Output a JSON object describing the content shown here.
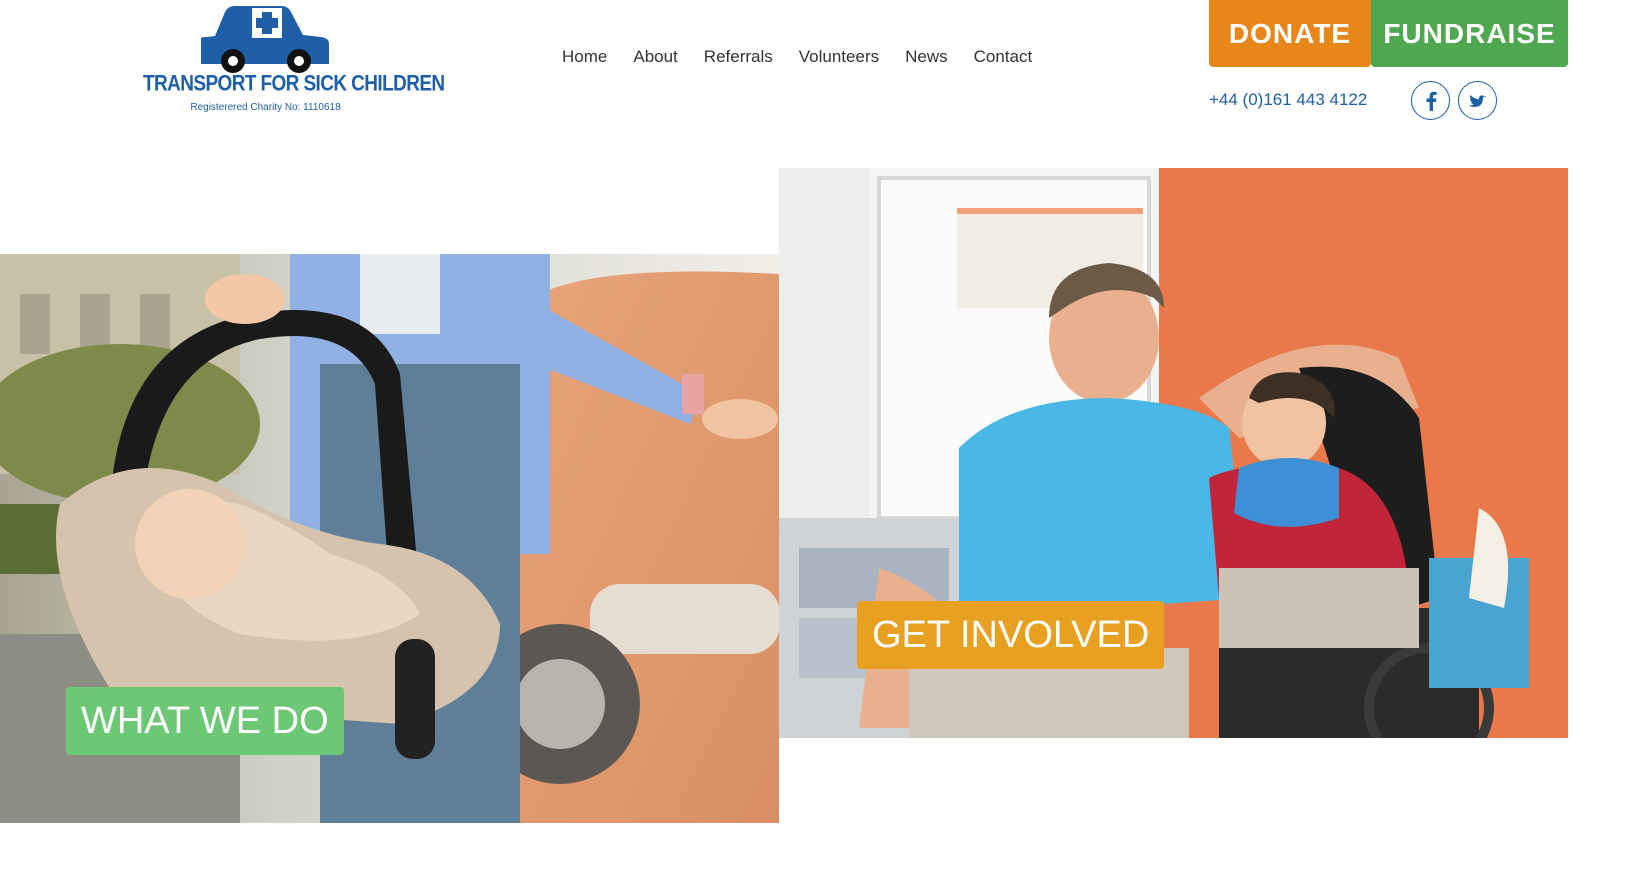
{
  "logo": {
    "name": "TRANSPORT FOR SICK CHILDREN",
    "charity": "Registerered Charity No: 1110618"
  },
  "nav": {
    "items": [
      {
        "label": "Home"
      },
      {
        "label": "About"
      },
      {
        "label": "Referrals"
      },
      {
        "label": "Volunteers"
      },
      {
        "label": "News"
      },
      {
        "label": "Contact"
      }
    ]
  },
  "header": {
    "donate_label": "DONATE",
    "fundraise_label": "FUNDRAISE",
    "phone": "+44 (0)161 443 4122",
    "social": [
      "facebook-icon",
      "twitter-icon"
    ]
  },
  "hero": {
    "what_label": "WHAT WE DO",
    "get_label": "GET INVOLVED"
  },
  "colors": {
    "brand_blue": "#1f5fa8",
    "donate_orange": "#e8861a",
    "fundraise_green": "#4fa84f",
    "what_green": "#6cc874",
    "get_orange": "#e8a020"
  }
}
